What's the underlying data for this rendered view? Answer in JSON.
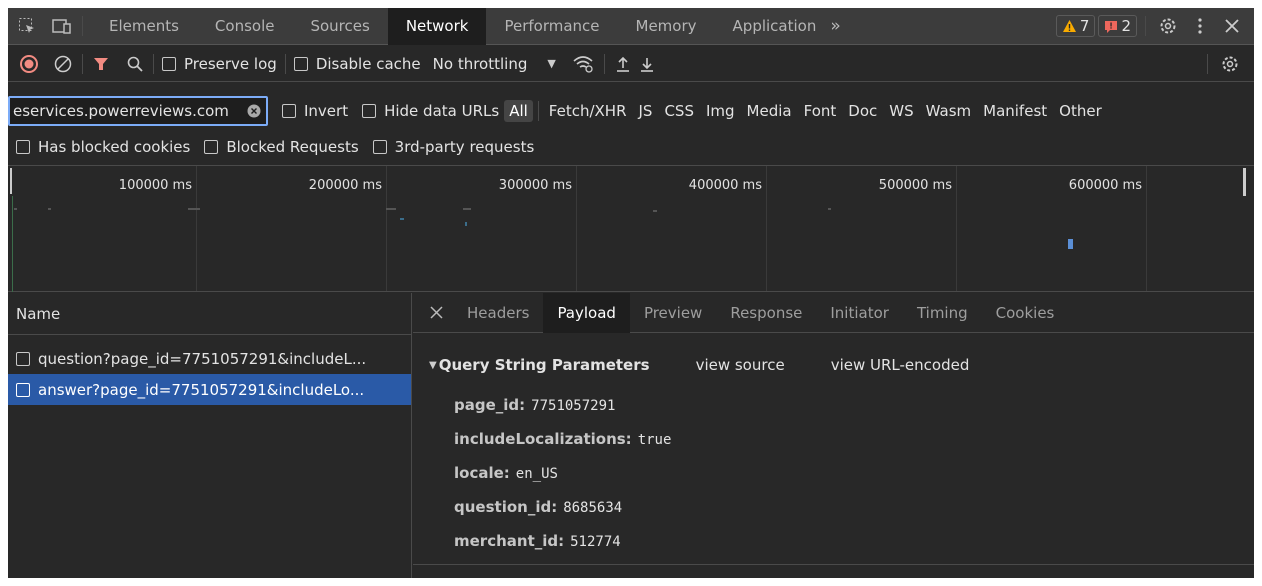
{
  "main_tabs": [
    "Elements",
    "Console",
    "Sources",
    "Network",
    "Performance",
    "Memory",
    "Application"
  ],
  "active_main_tab": "Network",
  "more_tabs": "»",
  "warnings_count": "7",
  "errors_count": "2",
  "toolbar": {
    "preserve_log": "Preserve log",
    "disable_cache": "Disable cache",
    "throttling": "No throttling"
  },
  "filter": {
    "value": "eservices.powerreviews.com",
    "invert": "Invert",
    "hide_data_urls": "Hide data URLs",
    "types": [
      "All",
      "Fetch/XHR",
      "JS",
      "CSS",
      "Img",
      "Media",
      "Font",
      "Doc",
      "WS",
      "Wasm",
      "Manifest",
      "Other"
    ],
    "active_type": "All"
  },
  "extra_filters": [
    "Has blocked cookies",
    "Blocked Requests",
    "3rd-party requests"
  ],
  "timeline_ticks": [
    "100000 ms",
    "200000 ms",
    "300000 ms",
    "400000 ms",
    "500000 ms",
    "600000 ms"
  ],
  "request_list": {
    "header": "Name",
    "items": [
      "question?page_id=7751057291&includeL...",
      "answer?page_id=7751057291&includeLo..."
    ]
  },
  "detail_tabs": [
    "Headers",
    "Payload",
    "Preview",
    "Response",
    "Initiator",
    "Timing",
    "Cookies"
  ],
  "active_detail_tab": "Payload",
  "payload": {
    "section_title": "Query String Parameters",
    "view_source": "view source",
    "view_url_encoded": "view URL-encoded",
    "params": [
      {
        "key": "page_id:",
        "value": "7751057291"
      },
      {
        "key": "includeLocalizations:",
        "value": "true"
      },
      {
        "key": "locale:",
        "value": "en_US"
      },
      {
        "key": "question_id:",
        "value": "8685634"
      },
      {
        "key": "merchant_id:",
        "value": "512774"
      }
    ]
  },
  "colors": {
    "record": "#f28b82",
    "filter_funnel": "#f28b82",
    "warning": "#f9ab00",
    "error": "#ee675c",
    "selected_row": "#2a5aa7",
    "focus_border": "#7cacf8"
  }
}
